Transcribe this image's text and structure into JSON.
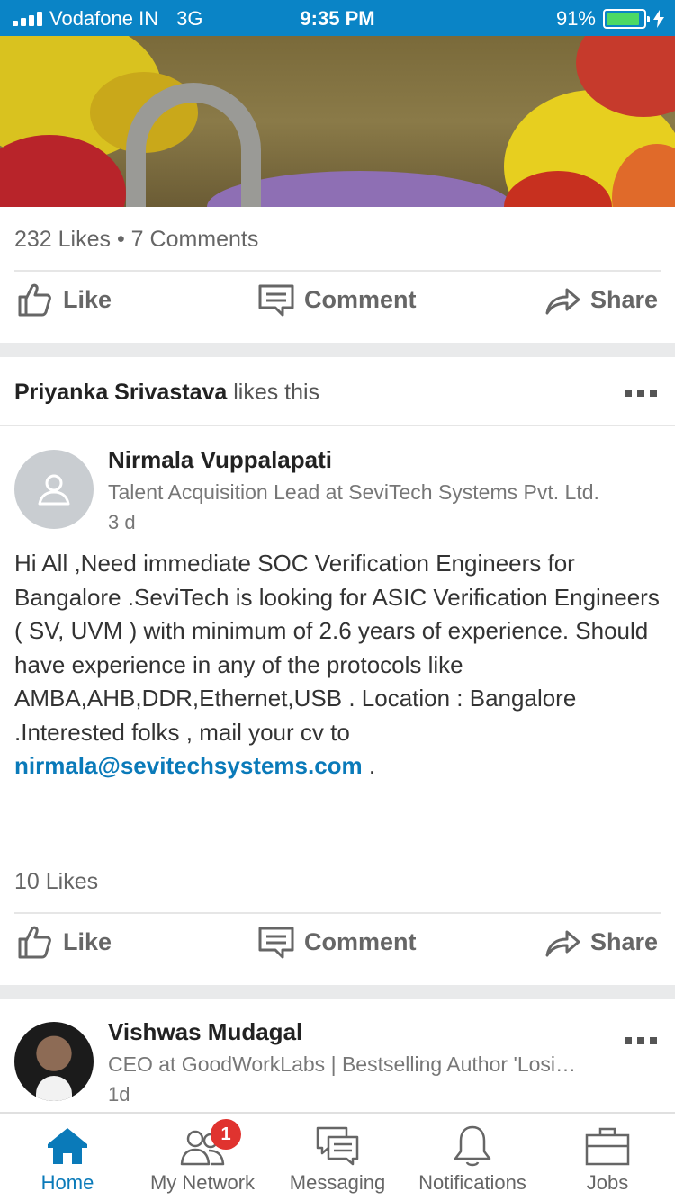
{
  "status_bar": {
    "carrier": "Vodafone IN",
    "network": "3G",
    "time": "9:35 PM",
    "battery": "91%",
    "battery_level": 0.91
  },
  "post1": {
    "stats": "232 Likes • 7 Comments",
    "actions": {
      "like": "Like",
      "comment": "Comment",
      "share": "Share"
    }
  },
  "post2": {
    "liker_name": "Priyanka Srivastava",
    "liker_suffix": " likes this",
    "author": "Nirmala Vuppalapati",
    "headline": "Talent Acquisition Lead at SeviTech Systems Pvt. Ltd.",
    "time": "3 d",
    "body_text": "Hi All ,Need immediate SOC Verification Engineers for Bangalore .SeviTech is looking for ASIC Verification Engineers ( SV, UVM ) with minimum of 2.6 years of experience. Should have experience in any of the protocols like AMBA,AHB,DDR,Ethernet,USB . Location : Bangalore .Interested folks , mail your cv to ",
    "email": "nirmala@sevitechsystems.com",
    "body_end": " .",
    "stats": "10 Likes",
    "actions": {
      "like": "Like",
      "comment": "Comment",
      "share": "Share"
    }
  },
  "post3": {
    "author": "Vishwas Mudagal",
    "headline": "CEO at GoodWorkLabs | Bestselling Author 'Losi…",
    "time": "1d"
  },
  "tabbar": {
    "home": "Home",
    "network": "My Network",
    "network_badge": "1",
    "messaging": "Messaging",
    "notifications": "Notifications",
    "jobs": "Jobs"
  },
  "colors": {
    "brand": "#0a84c6",
    "link": "#0a7ab9",
    "badge": "#e0332f"
  }
}
